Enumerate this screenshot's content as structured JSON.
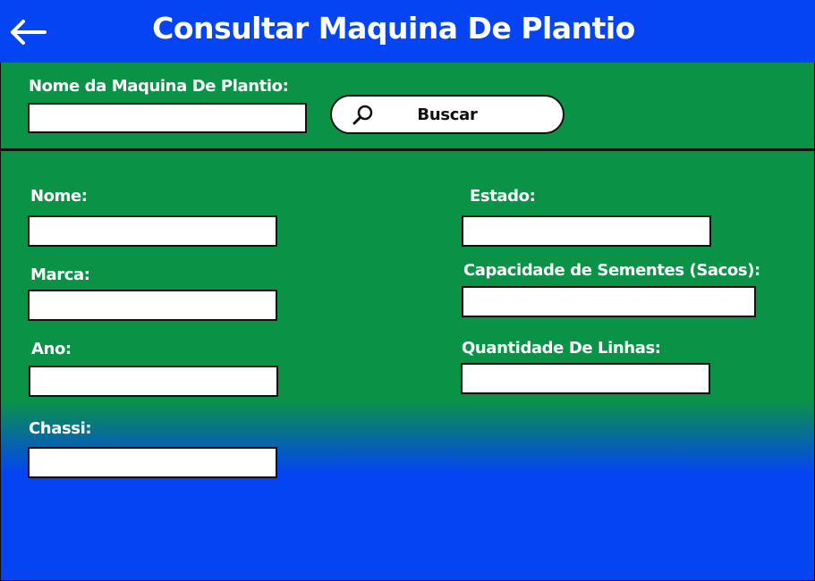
{
  "header": {
    "title": "Consultar Maquina De Plantio",
    "back_icon": "arrow-left-icon"
  },
  "search": {
    "label": "Nome da Maquina De Plantio:",
    "value": "",
    "button_label": "Buscar",
    "button_icon": "search-icon"
  },
  "form": {
    "nome": {
      "label": "Nome:",
      "value": ""
    },
    "marca": {
      "label": "Marca:",
      "value": ""
    },
    "ano": {
      "label": "Ano:",
      "value": ""
    },
    "chassi": {
      "label": "Chassi:",
      "value": ""
    },
    "estado": {
      "label": "Estado:",
      "value": ""
    },
    "capacidade": {
      "label": "Capacidade de Sementes (Sacos):",
      "value": ""
    },
    "linhas": {
      "label": "Quantidade De Linhas:",
      "value": ""
    }
  },
  "colors": {
    "header_blue": "#0444F2",
    "panel_green": "#0A9347",
    "text": "#FFFFFF",
    "border": "#111111"
  }
}
